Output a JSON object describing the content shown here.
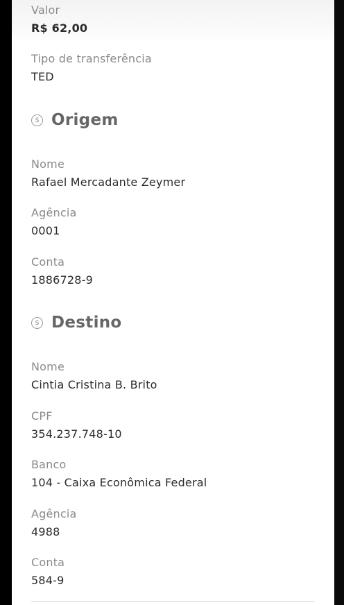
{
  "valor": {
    "label": "Valor",
    "value": "R$ 62,00"
  },
  "tipo": {
    "label": "Tipo de transferência",
    "value": "TED"
  },
  "origem": {
    "title": "Origem",
    "icon": "dollar-coin-icon",
    "icon_glyph": "$",
    "nome": {
      "label": "Nome",
      "value": "Rafael Mercadante Zeymer"
    },
    "agencia": {
      "label": "Agência",
      "value": "0001"
    },
    "conta": {
      "label": "Conta",
      "value": "1886728-9"
    }
  },
  "destino": {
    "title": "Destino",
    "icon": "dollar-coin-icon",
    "icon_glyph": "$",
    "nome": {
      "label": "Nome",
      "value": "Cintia Cristina B. Brito"
    },
    "cpf": {
      "label": "CPF",
      "value": "354.237.748-10"
    },
    "banco": {
      "label": "Banco",
      "value": "104 - Caixa Econômica Federal"
    },
    "agencia": {
      "label": "Agência",
      "value": "4988"
    },
    "conta": {
      "label": "Conta",
      "value": "584-9"
    }
  }
}
